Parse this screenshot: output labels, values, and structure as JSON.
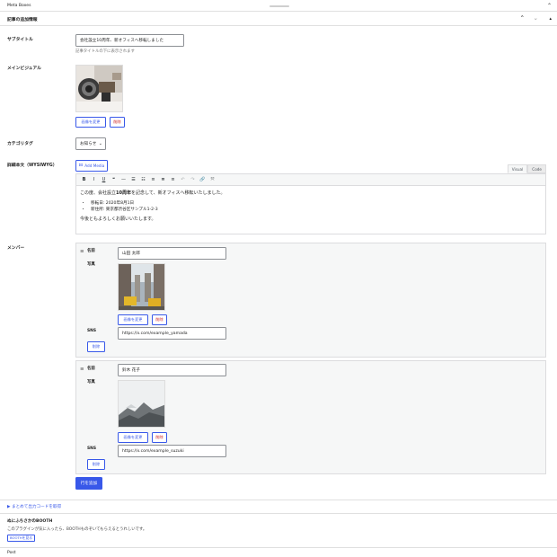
{
  "topbar": {
    "title": "Meta Boxes",
    "collapse_icon": "chevron-up-icon"
  },
  "panel": {
    "title": "記事の追加情報",
    "up_icon": "chevron-up-icon",
    "down_icon": "chevron-down-icon",
    "drag_icon": "triangle-icon"
  },
  "fields": {
    "subtitle": {
      "label": "サブタイトル",
      "value": "会社設立10周年、新オフィスへ移転しました",
      "hint": "記事タイトルの下に表示されます"
    },
    "main_visual": {
      "label": "メインビジュアル",
      "change_label": "画像を変更",
      "delete_label": "削除"
    },
    "category": {
      "label": "カテゴリタグ",
      "value": "お知らせ"
    },
    "body": {
      "label": "詳細本文（WYSIWYG）",
      "add_media": "Add Media",
      "tab_visual": "Visual",
      "tab_code": "Code",
      "para1_pre": "この度、会社設立",
      "para1_bold": "10周年",
      "para1_post": "を記念して、新オフィスへ移転いたしました。",
      "items": [
        "移転日: 2020年8月1日",
        "新住所: 東京都渋谷区サンプル1-2-3"
      ],
      "para2": "今後ともよろしくお願いいたします。"
    }
  },
  "members": {
    "label": "メンバー",
    "name_label": "名前",
    "photo_label": "写真",
    "sns_label": "SNS",
    "change_label": "画像を変更",
    "delete_img_label": "削除",
    "delete_row_label": "削除",
    "rows": [
      {
        "name": "山田 太郎",
        "sns": "https://x.com/example_yamada"
      },
      {
        "name": "鈴木 花子",
        "sns": "https://x.com/example_suzuki"
      }
    ],
    "add_row_label": "行を追加"
  },
  "code_link": "▶ まとめて出力コードを取得",
  "booth": {
    "title": "ぬにふちさかのBOOTH",
    "desc": "このプラグインが気に入ったら、BOOTHものぞいてもらえるとうれしいです。",
    "button": "BOOTHを見る"
  },
  "footer": "Post",
  "colors": {
    "accent": "#3858e9",
    "danger": "#cc1818",
    "border": "#8c8f94"
  }
}
